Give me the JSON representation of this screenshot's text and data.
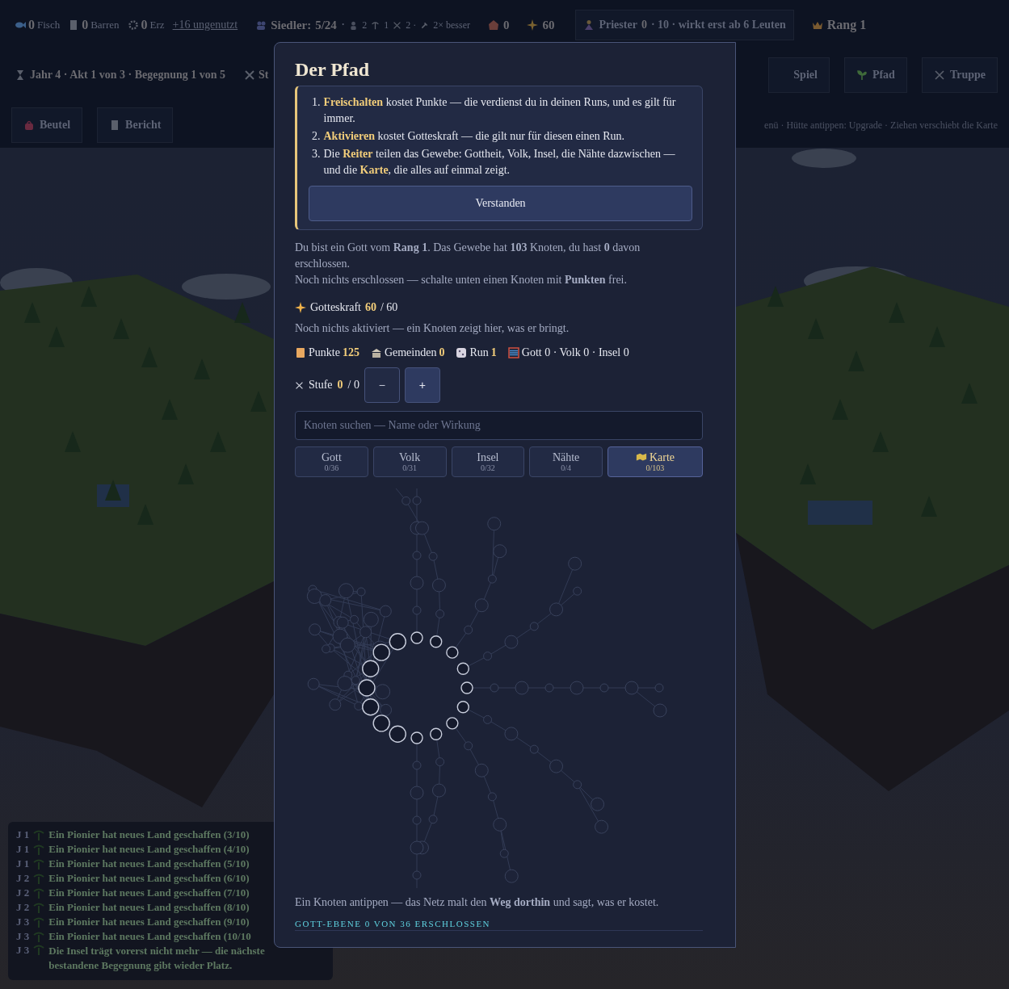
{
  "top_bar": {
    "resources": [
      {
        "value": "0",
        "label": "Fisch"
      },
      {
        "value": "0",
        "label": "Barren"
      },
      {
        "value": "0",
        "label": "Erz"
      }
    ],
    "unused_link": "+16 ungenutzt",
    "settlers": {
      "label": "Siedler:",
      "value": "5/24",
      "sep": "·"
    },
    "roles": [
      "2",
      "1",
      "2 ·"
    ],
    "bonus": "2× besser",
    "houses": "0",
    "power": "60",
    "priest": {
      "label": "Priester",
      "value": "0",
      "note": "· 10 · wirkt erst ab 6 Leuten"
    },
    "rank": "Rang 1"
  },
  "status_row": {
    "year_info": "Jahr **4** · Akt 1 von 3 · Begegnung 1 von 5",
    "cut_button": "St",
    "nav": [
      {
        "label": "Spiel"
      },
      {
        "label": "Pfad"
      },
      {
        "label": "Truppe"
      }
    ]
  },
  "action_row": {
    "buttons": [
      "Beutel",
      "Bericht"
    ],
    "hint": "enü · Hütte antippen: Upgrade · Ziehen verschiebt die Karte"
  },
  "log": [
    {
      "year": "J 1",
      "text": "Ein Pionier hat neues Land geschaffen (3/10)"
    },
    {
      "year": "J 1",
      "text": "Ein Pionier hat neues Land geschaffen (4/10)"
    },
    {
      "year": "J 1",
      "text": "Ein Pionier hat neues Land geschaffen (5/10)"
    },
    {
      "year": "J 2",
      "text": "Ein Pionier hat neues Land geschaffen (6/10)"
    },
    {
      "year": "J 2",
      "text": "Ein Pionier hat neues Land geschaffen (7/10)"
    },
    {
      "year": "J 2",
      "text": "Ein Pionier hat neues Land geschaffen (8/10)"
    },
    {
      "year": "J 3",
      "text": "Ein Pionier hat neues Land geschaffen (9/10)"
    },
    {
      "year": "J 3",
      "text": "Ein Pionier hat neues Land geschaffen (10/10"
    },
    {
      "year": "J 3",
      "text": "Die Insel trägt vorerst nicht mehr — die nächste bestandene Begegnung gibt wieder Platz."
    }
  ],
  "dialog": {
    "title": "Der Pfad",
    "intro": [
      {
        "number": "1.",
        "text": "**Freischalten** kostet Punkte — die verdienst du in deinen Runs, und es gilt für immer."
      },
      {
        "number": "2.",
        "text": "**Aktivieren** kostet Gotteskraft — die gilt nur für diesen einen Run."
      },
      {
        "number": "3.",
        "text": "Die **Reiter** teilen das Gewebe: Gottheit, Volk, Insel, die Nähte dazwischen — und die **Karte**, die alles auf einmal zeigt."
      }
    ],
    "confirm_button": "Verstanden",
    "summary": [
      "Du bist ein Gott vom **Rang 1**. Das Gewebe hat **103** Knoten, du hast **0** davon erschlossen.",
      "Noch nichts erschlossen — schalte unten einen Knoten mit **Punkten** frei."
    ],
    "power": {
      "label": "Gotteskraft",
      "value": "60",
      "max": "/ 60"
    },
    "active_note": "Noch nichts aktiviert — ein Knoten zeigt hier, was er bringt.",
    "stats": [
      {
        "label": "Punkte",
        "value": "125"
      },
      {
        "label": "Gemeinden",
        "value": "0"
      },
      {
        "label": "Run",
        "value": "1"
      },
      {
        "label": "Gott 0 · Volk 0 · Insel 0"
      }
    ],
    "level": {
      "label": "Stufe",
      "value": "0",
      "max": "/ 0",
      "buttons": [
        {
          "label": "−",
          "disabled": true
        },
        {
          "label": "+",
          "disabled": false
        }
      ]
    },
    "search": {
      "placeholder": "Knoten suchen — Name oder Wirkung"
    },
    "tabs": [
      {
        "label": "Gott",
        "count": "0/36",
        "selected": false
      },
      {
        "label": "Volk",
        "count": "0/31",
        "selected": false
      },
      {
        "label": "Insel",
        "count": "0/32",
        "selected": false
      },
      {
        "label": "Nähte",
        "count": "0/4",
        "selected": false
      },
      {
        "label": "Karte",
        "count": "0/103",
        "selected": true
      }
    ],
    "hint": "Ein Knoten antippen — das Netz malt den **Weg dorthin** und sagt, was er kostet.",
    "section": "GOTT-EBENE 0 VON 36 ERSCHLOSSEN"
  }
}
